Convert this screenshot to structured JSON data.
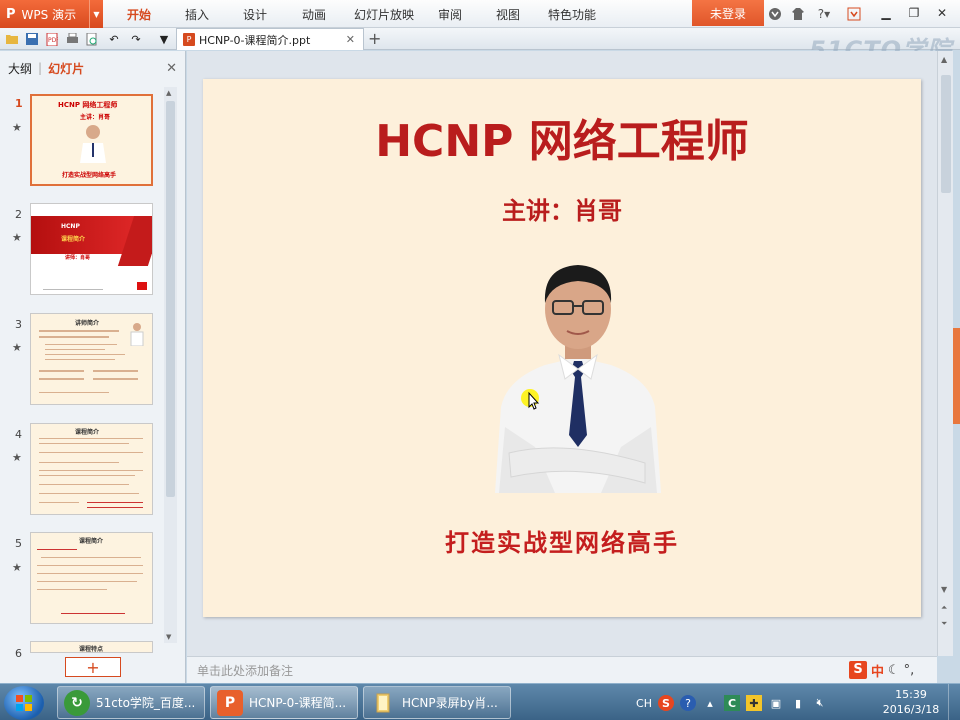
{
  "app": {
    "name": "WPS 演示",
    "logo_glyph": "P",
    "menu": [
      "开始",
      "插入",
      "设计",
      "动画",
      "幻灯片放映",
      "审阅",
      "视图",
      "特色功能"
    ],
    "active_menu": "开始",
    "login_label": "未登录",
    "help_label": "?"
  },
  "document": {
    "tab_title": "HCNP-0-课程简介.ppt",
    "file_icon_letter": "P"
  },
  "watermark": "51CTO学院",
  "left_panel": {
    "tabs": [
      "大纲",
      "幻灯片"
    ],
    "active_tab": "幻灯片",
    "thumbnails": [
      {
        "num": "1",
        "title": "HCNP  网络工程师",
        "sub": "主讲：肖哥",
        "slogan": "打造实战型网络高手"
      },
      {
        "num": "2",
        "title": "HCNP",
        "sub": "课程简介",
        "sub2": "讲师：肖哥"
      },
      {
        "num": "3",
        "title": "讲师简介"
      },
      {
        "num": "4",
        "title": "课程简介"
      },
      {
        "num": "5",
        "title": "课程简介"
      },
      {
        "num": "6",
        "title": "课程特点"
      }
    ],
    "add_label": "+"
  },
  "slide": {
    "title": "HCNP  网络工程师",
    "presenter": "主讲：肖哥",
    "slogan": "打造实战型网络高手"
  },
  "notes_placeholder": "单击此处添加备注",
  "ime": {
    "s_logo": "S",
    "lang": "中"
  },
  "taskbar": {
    "items": [
      {
        "label": "51cto学院_百度...",
        "color": "#3a9a3a"
      },
      {
        "label": "HCNP-0-课程简...",
        "color": "#e8602c"
      },
      {
        "label": "HCNP录屏by肖...",
        "color": "#e6b84a"
      }
    ],
    "tray_lang": "CH",
    "time": "15:39",
    "date": "2016/3/18"
  },
  "colors": {
    "accent": "#d64a1f",
    "slide_red": "#b91d1d",
    "slide_bg": "#fdf0db"
  }
}
